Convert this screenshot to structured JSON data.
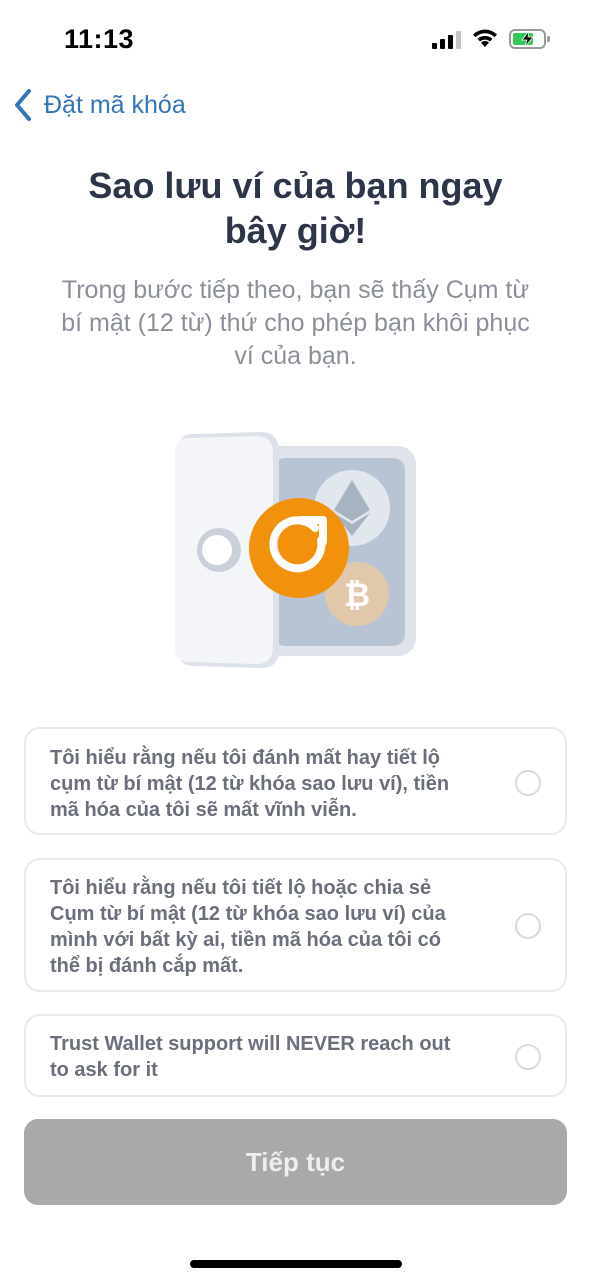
{
  "status_bar": {
    "time": "11:13",
    "icons": [
      "cellular-signal-icon",
      "wifi-icon",
      "battery-charging-icon"
    ]
  },
  "nav": {
    "back_label": "Đặt mã khóa",
    "back_icon": "chevron-left-icon"
  },
  "main": {
    "title_line1": "Sao lưu ví của bạn ngay",
    "title_line2": "bây giờ!",
    "subtitle_line1": "Trong bước tiếp theo, bạn sẽ thấy Cụm từ",
    "subtitle_line2": "bí mật (12 từ) thứ cho phép bạn khôi phục",
    "subtitle_line3": "ví của bạn.",
    "illustration_icon": "vault-backup-illustration"
  },
  "checklist": [
    {
      "lines": [
        "Tôi hiểu rằng nếu tôi đánh mất hay tiết lộ",
        "cụm từ bí mật (12 từ khóa sao lưu ví), tiền",
        "mã hóa của tôi sẽ mất vĩnh viễn."
      ],
      "checked": false
    },
    {
      "lines": [
        "Tôi hiểu rằng nếu tôi tiết lộ hoặc chia sẻ",
        "Cụm từ bí mật (12 từ khóa sao lưu ví) của",
        "mình với bất kỳ ai, tiền mã hóa của tôi có",
        "thể bị đánh cắp mất."
      ],
      "checked": false
    },
    {
      "lines": [
        "Trust Wallet support will NEVER reach out",
        "to ask for it"
      ],
      "checked": false
    }
  ],
  "continue_button": {
    "label": "Tiếp tục",
    "enabled": false
  },
  "colors": {
    "accent_blue": "#3375bb",
    "title": "#2c3648",
    "subtitle": "#8a8f99",
    "orange": "#f2920c",
    "button_disabled": "#a9a9a9"
  }
}
